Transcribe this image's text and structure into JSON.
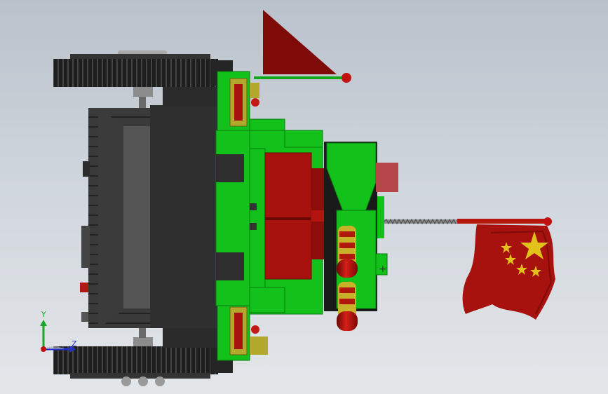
{
  "viewport": {
    "background_top": "#b9c1cb",
    "background_bottom": "#e3e6e9"
  },
  "model": {
    "colors": {
      "body_green": "#12c21a",
      "dark_green": "#0a8a12",
      "track_black": "#1e1e1e",
      "hull_gray": "#3a3a3a",
      "flag_red": "#a8120e",
      "flag_dark_red": "#7e0b08",
      "star_yellow": "#e0c21a",
      "gold": "#b2a82c"
    },
    "parts": [
      "left-track",
      "right-track",
      "hull",
      "turret",
      "gun-barrels",
      "pennant-flag",
      "china-flag",
      "spring-antenna"
    ]
  },
  "triad": {
    "y_label": "Y",
    "z_label": "Z",
    "y_color": "#1aa82a",
    "z_color": "#2233cc"
  }
}
